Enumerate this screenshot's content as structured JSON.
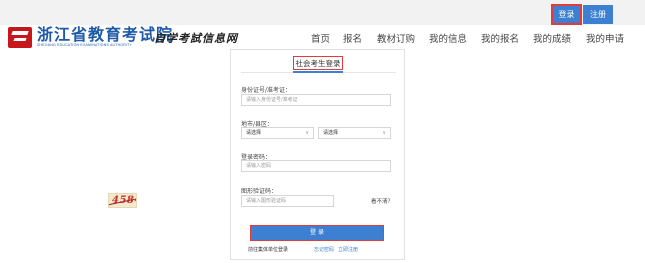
{
  "auth": {
    "login": "登录",
    "register": "注册"
  },
  "header": {
    "title_cn": "浙江省教育考试院",
    "title_en": "ZHEJIANG EDUCATION EXAMINATIONS AUTHORITY",
    "site_name": "自学考試信息网"
  },
  "nav": [
    "首页",
    "报名",
    "教材订购",
    "我的信息",
    "我的报名",
    "我的成绩",
    "我的申请"
  ],
  "form": {
    "tab": "社会考生登录",
    "id_label": "身份证号/准考证：",
    "id_placeholder": "请输入身份证号/准考证",
    "region_label": "地市/县区：",
    "city_value": "请选择",
    "district_value": "请选择",
    "password_label": "登录密码：",
    "password_placeholder": "请输入密码",
    "captcha_label": "图形验证码：",
    "captcha_placeholder": "请输入图形验证码",
    "captcha_text": "4584",
    "refresh_label": "看不清？",
    "submit_label": "登 录",
    "group_login": "前往集体单位登录",
    "forgot_password": "忘记密码",
    "register_now": "立即注册"
  },
  "colors": {
    "accent": "#3d7fd0",
    "highlight": "#e23b3b",
    "brand": "#c8161d"
  }
}
